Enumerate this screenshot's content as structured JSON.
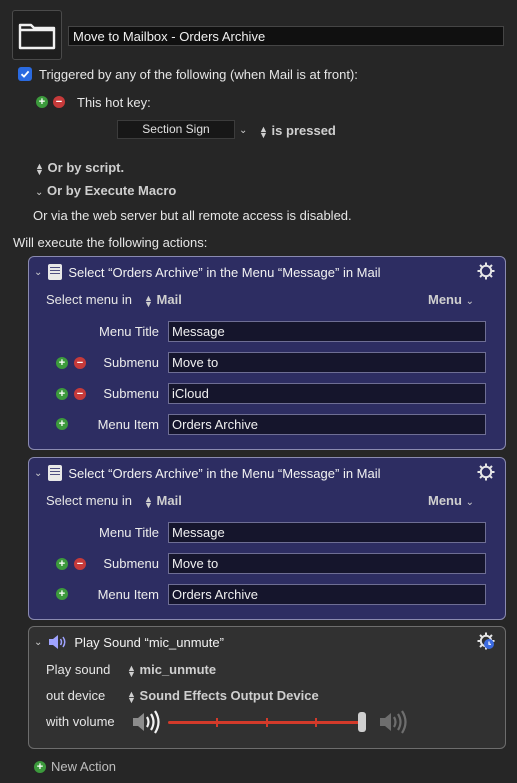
{
  "macro": {
    "name": "Move to Mailbox - Orders Archive"
  },
  "trigger": {
    "header": "Triggered by any of the following (when Mail is at front):",
    "hotkey_label": "This hot key:",
    "hotkey_value": "Section Sign",
    "hotkey_state": "is pressed",
    "or_script": "Or by script.",
    "or_execute": "Or by Execute Macro",
    "web_server": "Or via the web server but all remote access is disabled."
  },
  "will_execute": "Will execute the following actions:",
  "actions": [
    {
      "title": "Select “Orders Archive” in the Menu “Message” in Mail",
      "select_menu_in": "Select menu in",
      "app": "Mail",
      "menu_dropdown": "Menu",
      "fields": [
        {
          "label": "Menu Title",
          "value": "Message"
        },
        {
          "label": "Submenu",
          "value": "Move to"
        },
        {
          "label": "Submenu",
          "value": "iCloud"
        },
        {
          "label": "Menu Item",
          "value": "Orders Archive"
        }
      ]
    },
    {
      "title": "Select “Orders Archive” in the Menu “Message” in Mail",
      "select_menu_in": "Select menu in",
      "app": "Mail",
      "menu_dropdown": "Menu",
      "fields": [
        {
          "label": "Menu Title",
          "value": "Message"
        },
        {
          "label": "Submenu",
          "value": "Move to"
        },
        {
          "label": "Menu Item",
          "value": "Orders Archive"
        }
      ]
    },
    {
      "title": "Play Sound “mic_unmute”",
      "play_sound_label": "Play sound",
      "sound": "mic_unmute",
      "out_device_label": "out device",
      "device": "Sound Effects Output Device",
      "volume_label": "with volume",
      "volume": 1.0
    }
  ],
  "new_action": "New Action",
  "colors": {
    "accent": "#2a6ae0",
    "action_bg": "#2d2d62",
    "slider": "#d33a2a"
  }
}
